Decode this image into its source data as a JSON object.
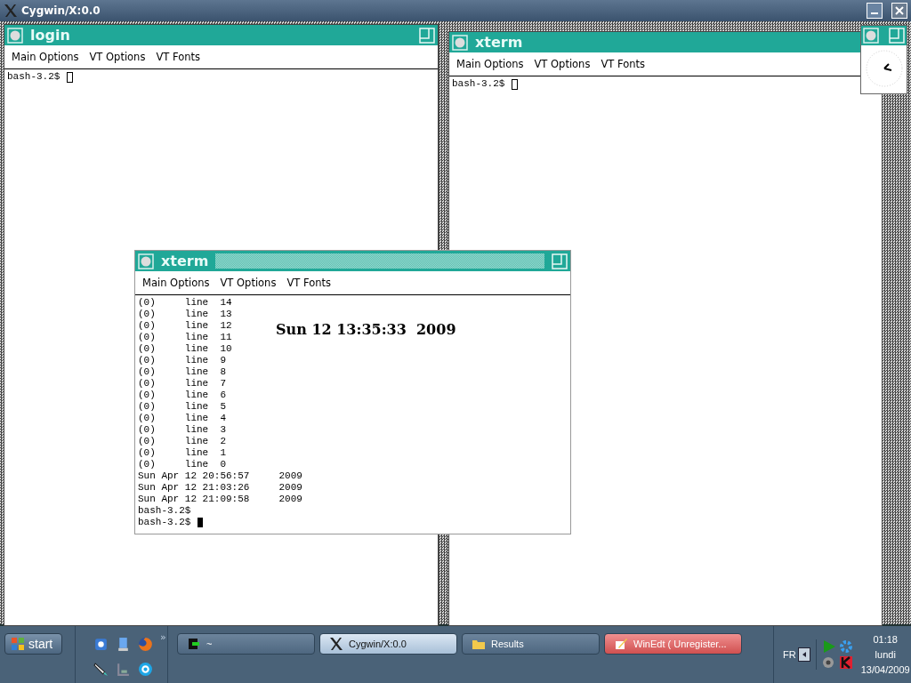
{
  "window": {
    "title": "Cygwin/X:0.0"
  },
  "xwindows": [
    {
      "title": "login",
      "focused": false,
      "menu": [
        "Main Options",
        "VT Options",
        "VT Fonts"
      ],
      "lines": [
        "bash-3.2$ "
      ]
    },
    {
      "title": "xterm",
      "focused": false,
      "menu": [
        "Main Options",
        "VT Options",
        "VT Fonts"
      ],
      "lines": [
        "bash-3.2$ "
      ]
    },
    {
      "title": "xterm",
      "focused": true,
      "menu": [
        "Main Options",
        "VT Options",
        "VT Fonts"
      ],
      "overlay": "Sun 12 13:35:33  2009",
      "lines": [
        "(0)     line  14",
        "(0)     line  13",
        "(0)     line  12",
        "(0)     line  11",
        "(0)     line  10",
        "(0)     line  9",
        "(0)     line  8",
        "(0)     line  7",
        "(0)     line  6",
        "(0)     line  5",
        "(0)     line  4",
        "(0)     line  3",
        "(0)     line  2",
        "(0)     line  1",
        "(0)     line  0",
        "Sun Apr 12 20:56:57     2009",
        "Sun Apr 12 21:03:26     2009",
        "Sun Apr 12 21:09:58     2009",
        "bash-3.2$",
        "bash-3.2$ "
      ]
    }
  ],
  "taskbar": {
    "start": "start",
    "more": "»",
    "tasks": [
      {
        "label": "~",
        "kind": "terminal",
        "selected": false,
        "flashing": false
      },
      {
        "label": "Cygwin/X:0.0",
        "kind": "x",
        "selected": true,
        "flashing": false
      },
      {
        "label": "Results",
        "kind": "folder",
        "selected": false,
        "flashing": false
      },
      {
        "label": "WinEdt  ( Unregister...",
        "kind": "editor",
        "selected": false,
        "flashing": true
      }
    ],
    "language": "FR",
    "time": "01:18",
    "day": "lundi",
    "date": "13/04/2009"
  }
}
